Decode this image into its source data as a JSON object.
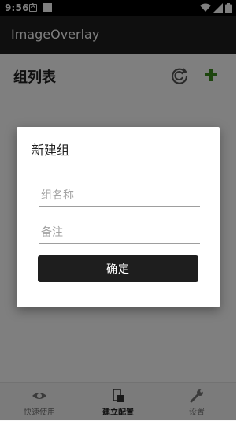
{
  "status_bar": {
    "time": "9:56"
  },
  "app_bar": {
    "title": "ImageOverlay"
  },
  "page": {
    "title": "组列表"
  },
  "bottom_nav": [
    {
      "label": "快速使用",
      "icon": "eye-icon"
    },
    {
      "label": "建立配置",
      "icon": "config-icon"
    },
    {
      "label": "设置",
      "icon": "wrench-icon"
    }
  ],
  "dialog": {
    "title": "新建组",
    "name_field": {
      "value": "",
      "placeholder": "组名称"
    },
    "note_field": {
      "value": "",
      "placeholder": "备注"
    },
    "confirm_label": "确定"
  },
  "colors": {
    "accent": "#3a8a1c",
    "app_bar": "#1f1f1f",
    "button": "#1e1e1e"
  }
}
